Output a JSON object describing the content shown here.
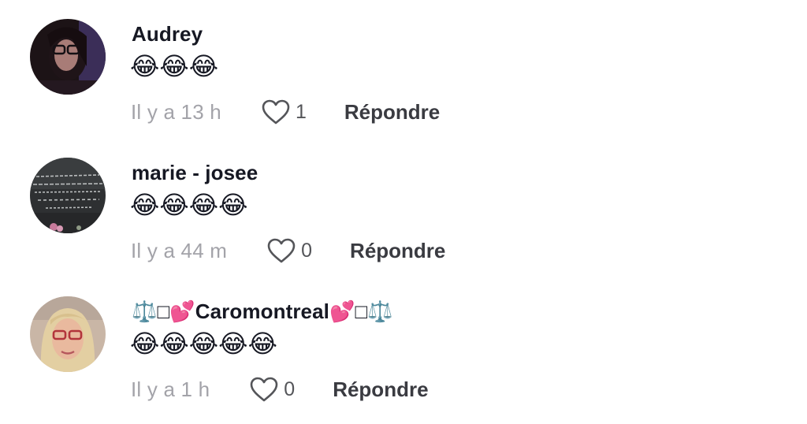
{
  "comments": [
    {
      "username": "Audrey",
      "text": "😂😂😂",
      "time": "Il y a 13 h",
      "likes": "1",
      "reply_label": "Répondre"
    },
    {
      "username": "marie - josee",
      "text": "😂😂😂😂",
      "time": "Il y a 44 m",
      "likes": "0",
      "reply_label": "Répondre"
    },
    {
      "username": "⚖️□💕Caromontreal💕□⚖️",
      "text": "😂😂😂😂😂",
      "time": "Il y a 1 h",
      "likes": "0",
      "reply_label": "Répondre"
    }
  ],
  "icons": {
    "like": "heart-outline-icon"
  },
  "colors": {
    "username": "#161823",
    "time": "#a3a3a9",
    "count": "#545559",
    "reply": "#3a3b41"
  }
}
